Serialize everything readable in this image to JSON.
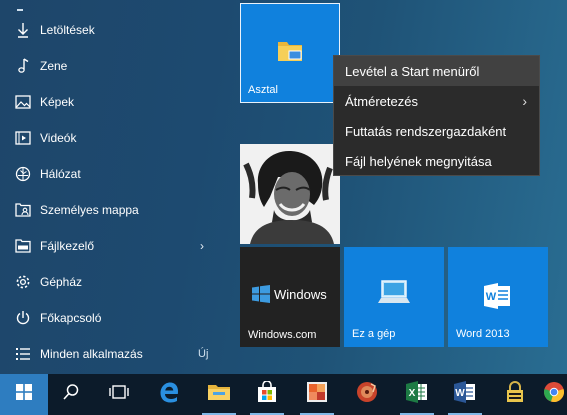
{
  "start_menu": {
    "items": [
      {
        "label": "Letöltések",
        "icon": "download-icon"
      },
      {
        "label": "Zene",
        "icon": "music-note-icon"
      },
      {
        "label": "Képek",
        "icon": "pictures-icon"
      },
      {
        "label": "Videók",
        "icon": "video-icon"
      },
      {
        "label": "Hálózat",
        "icon": "network-icon"
      },
      {
        "label": "Személyes mappa",
        "icon": "user-folder-icon"
      },
      {
        "label": "Fájlkezelő",
        "icon": "file-explorer-icon",
        "arrow": "›"
      },
      {
        "label": "Gépház",
        "icon": "gear-icon"
      },
      {
        "label": "Főkapcsoló",
        "icon": "power-icon"
      },
      {
        "label": "Minden alkalmazás",
        "icon": "all-apps-icon",
        "badge": "Új"
      }
    ]
  },
  "tiles": {
    "desktop": "Asztal",
    "windows_logo_text": "Windows",
    "windows_sub": "Windows.com",
    "this_pc": "Ez a gép",
    "word": "Word 2013"
  },
  "context_menu": {
    "items": [
      {
        "label": "Levétel a Start menüről"
      },
      {
        "label": "Átméretezés",
        "submenu": "›"
      },
      {
        "label": "Futtatás rendszergazdaként"
      },
      {
        "label": "Fájl helyének megnyitása"
      }
    ]
  },
  "taskbar": {
    "icons": [
      "windows-start-icon",
      "search-icon",
      "task-view-icon",
      "edge-icon",
      "file-explorer-icon",
      "store-icon",
      "office-icon",
      "music-app-icon",
      "excel-icon",
      "word-icon",
      "lock-app-icon",
      "chrome-icon"
    ]
  },
  "colors": {
    "accent": "#1081dd",
    "start_button": "#2e7dc0",
    "taskbar": "#0c1b2a",
    "context_menu": "#2b2b2b"
  }
}
